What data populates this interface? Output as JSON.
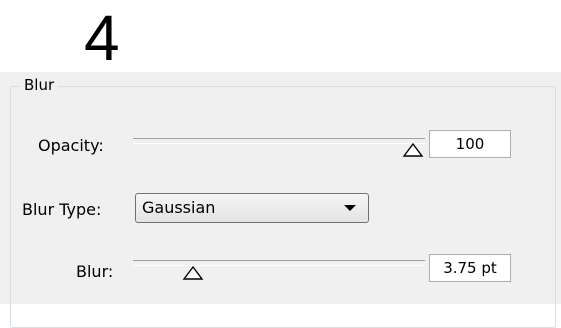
{
  "step_number": "4",
  "blur_group": {
    "title": "Blur",
    "opacity": {
      "label": "Opacity:",
      "value": "100",
      "slider_level": 1.0
    },
    "blur_type": {
      "label": "Blur Type:",
      "selected": "Gaussian"
    },
    "blur": {
      "label": "Blur:",
      "value": "3.75 pt",
      "slider_level": 0.2
    }
  },
  "colors": {
    "panel_bg": "#f0f0f0",
    "group_border": "#d5dfe5"
  },
  "icons": {
    "slider_thumb": "triangle-slider-thumb-icon",
    "dropdown_arrow": "chevron-down-icon"
  }
}
